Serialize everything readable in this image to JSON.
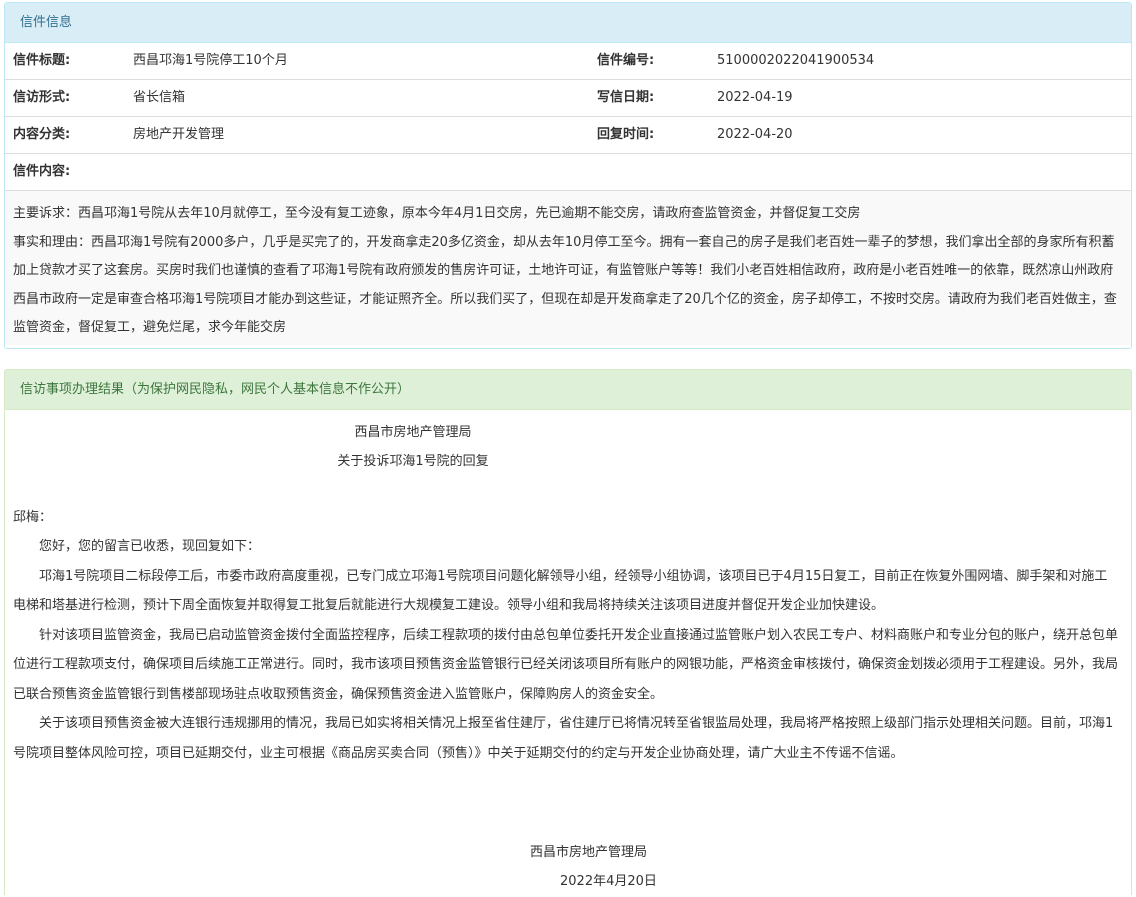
{
  "letter_panel": {
    "heading": "信件信息",
    "rows": [
      {
        "label1": "信件标题:",
        "value1": "西昌邛海1号院停工10个月",
        "label2": "信件编号:",
        "value2": "5100002022041900534"
      },
      {
        "label1": "信访形式:",
        "value1": "省长信箱",
        "label2": "写信日期:",
        "value2": "2022-04-19"
      },
      {
        "label1": "内容分类:",
        "value1": "房地产开发管理",
        "label2": "回复时间:",
        "value2": "2022-04-20"
      }
    ],
    "content_label": "信件内容:",
    "content_paragraphs": [
      "主要诉求：西昌邛海1号院从去年10月就停工，至今没有复工迹象，原本今年4月1日交房，先已逾期不能交房，请政府查监管资金，并督促复工交房",
      "事实和理由：西昌邛海1号院有2000多户，几乎是买完了的，开发商拿走20多亿资金，却从去年10月停工至今。拥有一套自己的房子是我们老百姓一辈子的梦想，我们拿出全部的身家所有积蓄加上贷款才买了这套房。买房时我们也谨慎的查看了邛海1号院有政府颁发的售房许可证，土地许可证，有监管账户等等！我们小老百姓相信政府，政府是小老百姓唯一的依靠，既然凉山州政府西昌市政府一定是审查合格邛海1号院项目才能办到这些证，才能证照齐全。所以我们买了，但现在却是开发商拿走了20几个亿的资金，房子却停工，不按时交房。请政府为我们老百姓做主，查监管资金，督促复工，避免烂尾，求今年能交房"
    ]
  },
  "result_panel": {
    "heading": "信访事项办理结果（为保护网民隐私，网民个人基本信息不作公开）",
    "reply_org": "西昌市房地产管理局",
    "reply_subject": "关于投诉邛海1号院的回复",
    "salutation": "邱梅：",
    "paragraphs": [
      "您好，您的留言已收悉，现回复如下：",
      "邛海1号院项目二标段停工后，市委市政府高度重视，已专门成立邛海1号院项目问题化解领导小组，经领导小组协调，该项目已于4月15日复工，目前正在恢复外围网墙、脚手架和对施工电梯和塔基进行检测，预计下周全面恢复并取得复工批复后就能进行大规模复工建设。领导小组和我局将持续关注该项目进度并督促开发企业加快建设。",
      "针对该项目监管资金，我局已启动监管资金拨付全面监控程序，后续工程款项的拨付由总包单位委托开发企业直接通过监管账户划入农民工专户、材料商账户和专业分包的账户，绕开总包单位进行工程款项支付，确保项目后续施工正常进行。同时，我市该项目预售资金监管银行已经关闭该项目所有账户的网银功能，严格资金审核拨付，确保资金划拨必须用于工程建设。另外，我局已联合预售资金监管银行到售楼部现场驻点收取预售资金，确保预售资金进入监管账户，保障购房人的资金安全。",
      "关于该项目预售资金被大连银行违规挪用的情况，我局已如实将相关情况上报至省住建厅，省住建厅已将情况转至省银监局处理，我局将严格按照上级部门指示处理相关问题。目前，邛海1号院项目整体风险可控，项目已延期交付，业主可根据《商品房买卖合同（预售）》中关于延期交付的约定与开发企业协商处理，请广大业主不传谣不信谣。"
    ],
    "sign_org": "西昌市房地产管理局",
    "sign_date": "2022年4月20日"
  }
}
